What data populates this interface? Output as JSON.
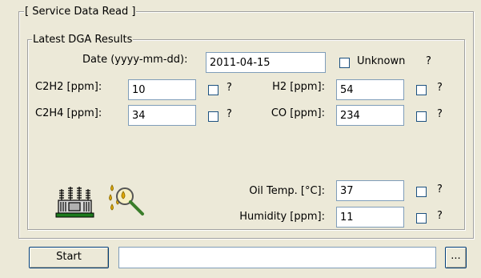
{
  "outer_group": {
    "title": "[ Service Data Read ]"
  },
  "dga_group": {
    "title": "Latest DGA Results"
  },
  "date": {
    "label": "Date (yyyy-mm-dd):",
    "value": "2011-04-15",
    "unknown_label": "Unknown",
    "help": "?"
  },
  "c2h2": {
    "label": "C2H2 [ppm]:",
    "value": "10",
    "help": "?"
  },
  "c2h4": {
    "label": "C2H4 [ppm]:",
    "value": "34",
    "help": "?"
  },
  "h2": {
    "label": "H2 [ppm]:",
    "value": "54",
    "help": "?"
  },
  "co": {
    "label": "CO [ppm]:",
    "value": "234",
    "help": "?"
  },
  "oil_temp": {
    "label": "Oil Temp. [°C]:",
    "value": "37",
    "help": "?"
  },
  "humidity": {
    "label": "Humidity [ppm]:",
    "value": "11",
    "help": "?"
  },
  "actions": {
    "start_label": "Start",
    "status_value": "",
    "browse_label": "..."
  },
  "icons": [
    "transformer-icon",
    "oil-drops-magnifier-icon"
  ],
  "colors": {
    "background": "#ece9d8",
    "field_border": "#7f9db9",
    "checkbox_border": "#1c5180",
    "group_border": "#a0a0a0"
  }
}
